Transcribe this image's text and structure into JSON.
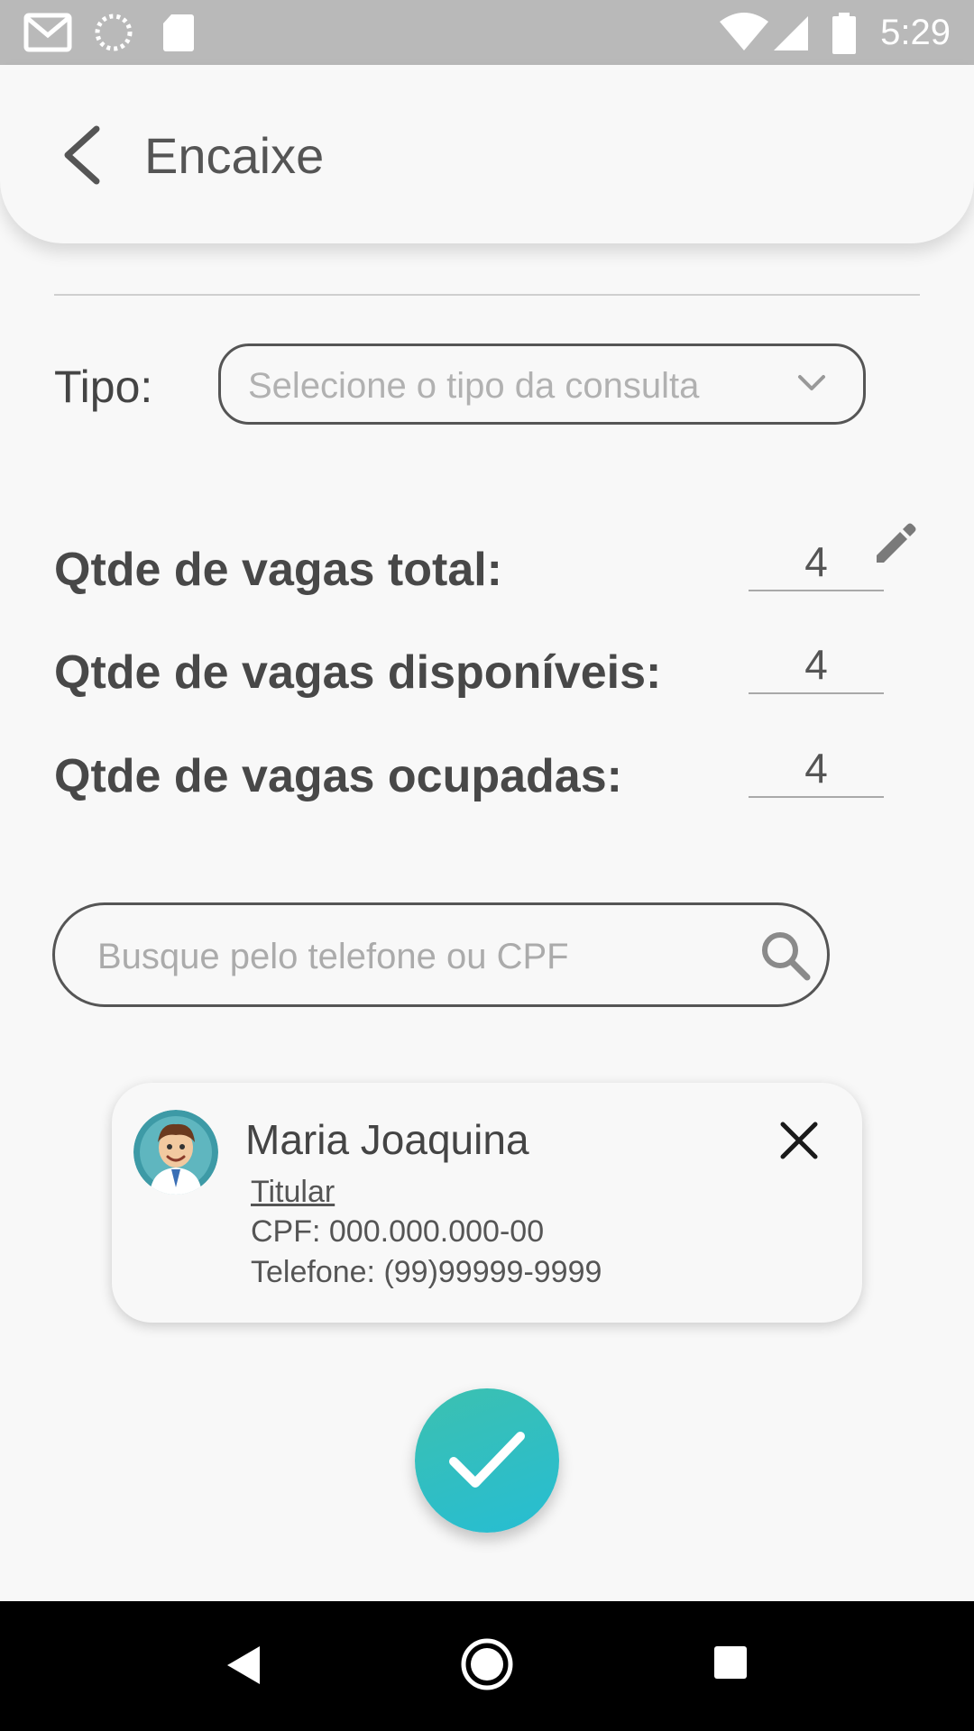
{
  "status_bar": {
    "time": "5:29",
    "icons": [
      "gmail-icon",
      "sync-icon",
      "sd-card-icon",
      "wifi-icon",
      "signal-icon",
      "battery-icon"
    ]
  },
  "header": {
    "title": "Encaixe",
    "back_icon": "chevron-left-icon"
  },
  "tipo": {
    "label": "Tipo:",
    "placeholder": "Selecione o tipo da consulta"
  },
  "vagas": [
    {
      "label": "Qtde de vagas total:",
      "value": "4"
    },
    {
      "label": "Qtde de vagas disponíveis:",
      "value": "4"
    },
    {
      "label": "Qtde de vagas ocupadas:",
      "value": "4"
    }
  ],
  "search": {
    "placeholder": "Busque pelo telefone ou CPF"
  },
  "patient": {
    "name": "Maria Joaquina",
    "role": "Titular",
    "cpf": "CPF: 000.000.000-00",
    "phone": "Telefone: (99)99999-9999"
  },
  "colors": {
    "accent": "#2fbfc4",
    "status_bar": "#b9b9b9",
    "background": "#f8f8f8"
  }
}
